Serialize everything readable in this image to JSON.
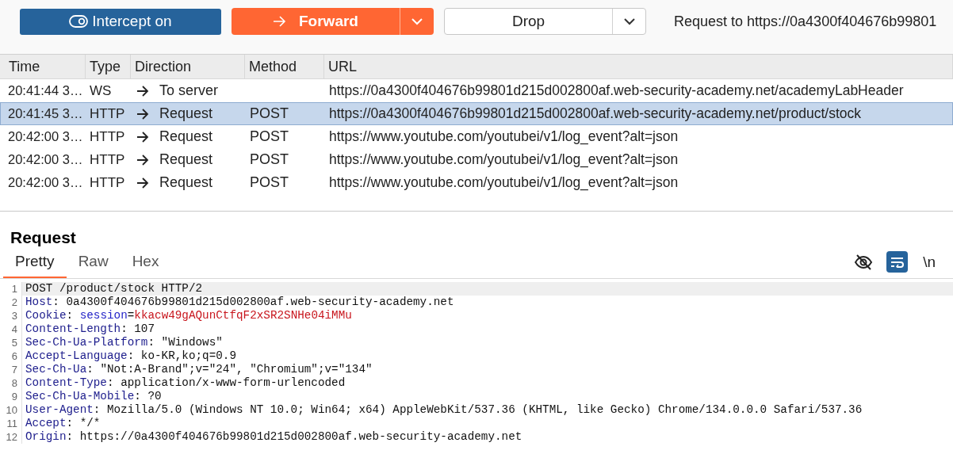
{
  "toolbar": {
    "intercept_button": "Intercept on",
    "forward_button": "Forward",
    "drop_button": "Drop",
    "request_info": "Request to https://0a4300f404676b99801"
  },
  "table": {
    "columns": [
      "Time",
      "Type",
      "Direction",
      "Method",
      "URL"
    ],
    "rows": [
      {
        "time": "20:41:44 3…",
        "type": "WS",
        "direction": "To server",
        "method": "",
        "url": "https://0a4300f404676b99801d215d002800af.web-security-academy.net/academyLabHeader",
        "selected": false
      },
      {
        "time": "20:41:45 3…",
        "type": "HTTP",
        "direction": "Request",
        "method": "POST",
        "url": "https://0a4300f404676b99801d215d002800af.web-security-academy.net/product/stock",
        "selected": true
      },
      {
        "time": "20:42:00 3…",
        "type": "HTTP",
        "direction": "Request",
        "method": "POST",
        "url": "https://www.youtube.com/youtubei/v1/log_event?alt=json",
        "selected": false
      },
      {
        "time": "20:42:00 3…",
        "type": "HTTP",
        "direction": "Request",
        "method": "POST",
        "url": "https://www.youtube.com/youtubei/v1/log_event?alt=json",
        "selected": false
      },
      {
        "time": "20:42:00 3…",
        "type": "HTTP",
        "direction": "Request",
        "method": "POST",
        "url": "https://www.youtube.com/youtubei/v1/log_event?alt=json",
        "selected": false
      }
    ]
  },
  "request": {
    "title": "Request",
    "tabs": [
      {
        "label": "Pretty",
        "selected": true
      },
      {
        "label": "Raw",
        "selected": false
      },
      {
        "label": "Hex",
        "selected": false
      }
    ],
    "wrap_toggle": {
      "on": true
    },
    "newline_button": "\\n",
    "lines": [
      {
        "number": "1",
        "current": true,
        "segments": [
          {
            "kind": "plain",
            "text": "POST /product/stock HTTP/2"
          }
        ]
      },
      {
        "number": "2",
        "current": false,
        "segments": [
          {
            "kind": "key",
            "text": "Host"
          },
          {
            "kind": "plain",
            "text": ": 0a4300f404676b99801d215d002800af.web-security-academy.net"
          }
        ]
      },
      {
        "number": "3",
        "current": false,
        "segments": [
          {
            "kind": "key",
            "text": "Cookie"
          },
          {
            "kind": "plain",
            "text": ": "
          },
          {
            "kind": "param",
            "text": "session"
          },
          {
            "kind": "plain",
            "text": "="
          },
          {
            "kind": "value",
            "text": "kkacw49gAQunCtfqF2xSR2SNHe04iMMu"
          }
        ]
      },
      {
        "number": "4",
        "current": false,
        "segments": [
          {
            "kind": "key",
            "text": "Content-Length"
          },
          {
            "kind": "plain",
            "text": ": 107"
          }
        ]
      },
      {
        "number": "5",
        "current": false,
        "segments": [
          {
            "kind": "key",
            "text": "Sec-Ch-Ua-Platform"
          },
          {
            "kind": "plain",
            "text": ": \"Windows\""
          }
        ]
      },
      {
        "number": "6",
        "current": false,
        "segments": [
          {
            "kind": "key",
            "text": "Accept-Language"
          },
          {
            "kind": "plain",
            "text": ": ko-KR,ko;q=0.9"
          }
        ]
      },
      {
        "number": "7",
        "current": false,
        "segments": [
          {
            "kind": "key",
            "text": "Sec-Ch-Ua"
          },
          {
            "kind": "plain",
            "text": ": \"Not:A-Brand\";v=\"24\", \"Chromium\";v=\"134\""
          }
        ]
      },
      {
        "number": "8",
        "current": false,
        "segments": [
          {
            "kind": "key",
            "text": "Content-Type"
          },
          {
            "kind": "plain",
            "text": ": application/x-www-form-urlencoded"
          }
        ]
      },
      {
        "number": "9",
        "current": false,
        "segments": [
          {
            "kind": "key",
            "text": "Sec-Ch-Ua-Mobile"
          },
          {
            "kind": "plain",
            "text": ": ?0"
          }
        ]
      },
      {
        "number": "10",
        "current": false,
        "segments": [
          {
            "kind": "key",
            "text": "User-Agent"
          },
          {
            "kind": "plain",
            "text": ": Mozilla/5.0 (Windows NT 10.0; Win64; x64) AppleWebKit/537.36 (KHTML, like Gecko) Chrome/134.0.0.0 Safari/537.36"
          }
        ]
      },
      {
        "number": "11",
        "current": false,
        "segments": [
          {
            "kind": "key",
            "text": "Accept"
          },
          {
            "kind": "plain",
            "text": ": */*"
          }
        ]
      },
      {
        "number": "12",
        "current": false,
        "segments": [
          {
            "kind": "key",
            "text": "Origin"
          },
          {
            "kind": "plain",
            "text": ": https://0a4300f404676b99801d215d002800af.web-security-academy.net"
          }
        ]
      }
    ]
  }
}
